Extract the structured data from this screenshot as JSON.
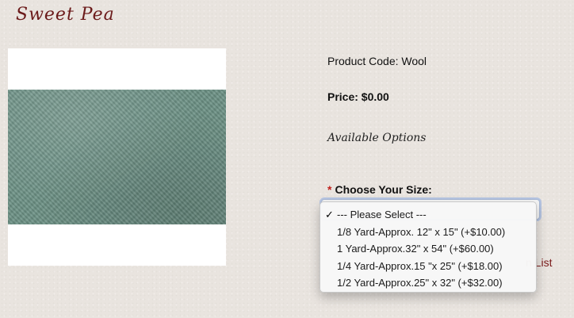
{
  "header": {
    "title": "Sweet Pea"
  },
  "product": {
    "code_label": "Product Code: Wool",
    "price_label": "Price: $0.00",
    "options_heading": "Available Options",
    "image_alt_colors": {
      "fabric": "#6c9185"
    }
  },
  "size_option": {
    "required_marker": "*",
    "label": "Choose Your Size:",
    "selected_index": 0,
    "options": [
      "--- Please Select ---",
      "1/8 Yard-Approx. 12\" x 15\" (+$10.00)",
      "1 Yard-Approx.32\" x 54\" (+$60.00)",
      "1/4 Yard-Approx.15 \"x 25\" (+$18.00)",
      "1/2 Yard-Approx.25\" x 32\" (+$32.00)"
    ]
  },
  "wishlist": {
    "partial_label": "n List"
  },
  "icons": {
    "check": "✓"
  },
  "colors": {
    "title": "#6b1a1a",
    "required": "#c0201c",
    "link": "#7a1a1a"
  }
}
